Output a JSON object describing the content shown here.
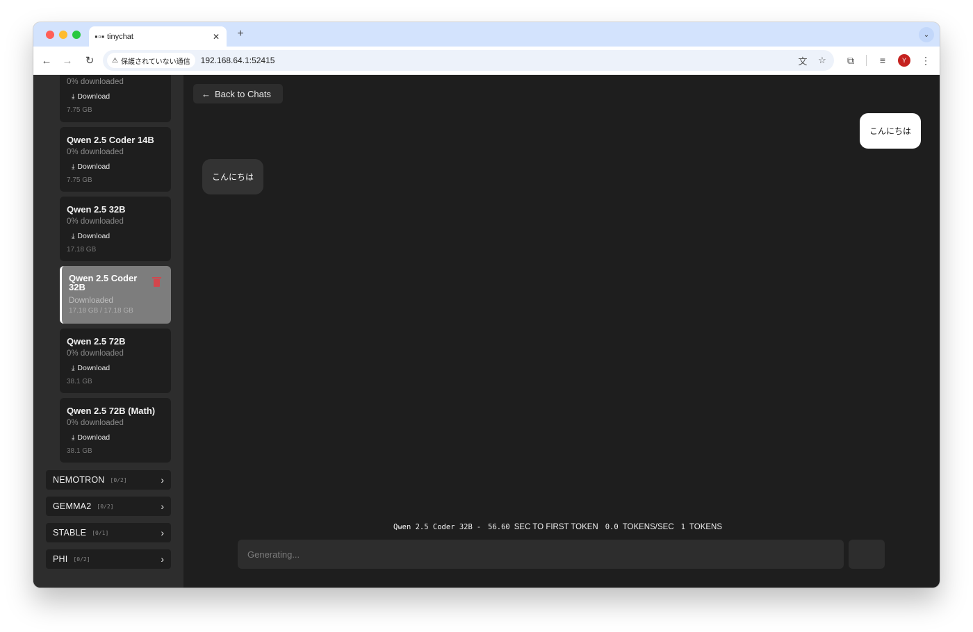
{
  "browser": {
    "tab_favicon": "tinygrad-logo",
    "tab_title": "tinychat",
    "tab_close": "✕",
    "new_tab": "+",
    "security_label": "保護されていない通信",
    "url": "192.168.64.1:52415",
    "profile_initial": "Y"
  },
  "sidebar": {
    "models": [
      {
        "name": "",
        "status": "0% downloaded",
        "download_label": "Download",
        "size": "7.75 GB"
      },
      {
        "name": "Qwen 2.5 Coder 14B",
        "status": "0% downloaded",
        "download_label": "Download",
        "size": "7.75 GB"
      },
      {
        "name": "Qwen 2.5 32B",
        "status": "0% downloaded",
        "download_label": "Download",
        "size": "17.18 GB"
      },
      {
        "name": "Qwen 2.5 Coder 32B",
        "status": "Downloaded",
        "size": "17.18 GB / 17.18 GB",
        "selected": true
      },
      {
        "name": "Qwen 2.5 72B",
        "status": "0% downloaded",
        "download_label": "Download",
        "size": "38.1 GB"
      },
      {
        "name": "Qwen 2.5 72B (Math)",
        "status": "0% downloaded",
        "download_label": "Download",
        "size": "38.1 GB"
      }
    ],
    "groups": [
      {
        "name": "NEMOTRON",
        "count": "[0/2]"
      },
      {
        "name": "GEMMA2",
        "count": "[0/2]"
      },
      {
        "name": "STABLE",
        "count": "[0/1]"
      },
      {
        "name": "PHI",
        "count": "[0/2]"
      }
    ]
  },
  "chat": {
    "back_label": "Back to Chats",
    "messages": [
      {
        "role": "user",
        "text": "こんにちは"
      },
      {
        "role": "assistant",
        "text": "こんにちは"
      }
    ],
    "stats": {
      "model": "Qwen 2.5 Coder 32B",
      "separator": "-",
      "ttft_value": "56.60",
      "ttft_label": "SEC TO FIRST TOKEN",
      "tps_value": "0.0",
      "tps_label": "TOKENS/SEC",
      "tokens_value": "1",
      "tokens_label": "TOKENS"
    },
    "input_placeholder": "Generating..."
  },
  "colors": {
    "background": "#1e1e1e",
    "sidebar": "#2d2d2d",
    "selected_card": "#7d7d7d",
    "delete": "#d3464c"
  }
}
